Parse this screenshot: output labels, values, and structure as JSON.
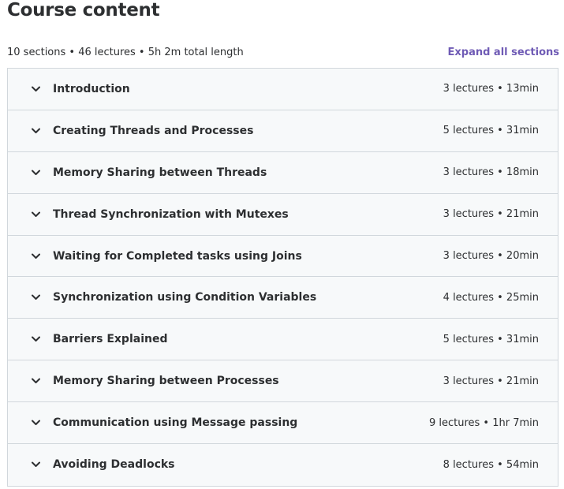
{
  "header": {
    "title": "Course content",
    "summary": "10 sections • 46 lectures • 5h 2m total length",
    "expand_all_label": "Expand all sections"
  },
  "icons": {
    "chevron": "chevron-down-icon"
  },
  "colors": {
    "accent": "#6f5bb5",
    "row_background": "#f7f9fa",
    "border": "#d1d7dc",
    "text": "#2d2f31"
  },
  "sections": [
    {
      "title": "Introduction",
      "meta": "3 lectures • 13min"
    },
    {
      "title": "Creating Threads and Processes",
      "meta": "5 lectures • 31min"
    },
    {
      "title": "Memory Sharing between Threads",
      "meta": "3 lectures • 18min"
    },
    {
      "title": "Thread Synchronization with Mutexes",
      "meta": "3 lectures • 21min"
    },
    {
      "title": "Waiting for Completed tasks using Joins",
      "meta": "3 lectures • 20min"
    },
    {
      "title": "Synchronization using Condition Variables",
      "meta": "4 lectures • 25min"
    },
    {
      "title": "Barriers Explained",
      "meta": "5 lectures • 31min"
    },
    {
      "title": "Memory Sharing between Processes",
      "meta": "3 lectures • 21min"
    },
    {
      "title": "Communication using Message passing",
      "meta": "9 lectures • 1hr 7min"
    },
    {
      "title": "Avoiding Deadlocks",
      "meta": "8 lectures • 54min"
    }
  ]
}
